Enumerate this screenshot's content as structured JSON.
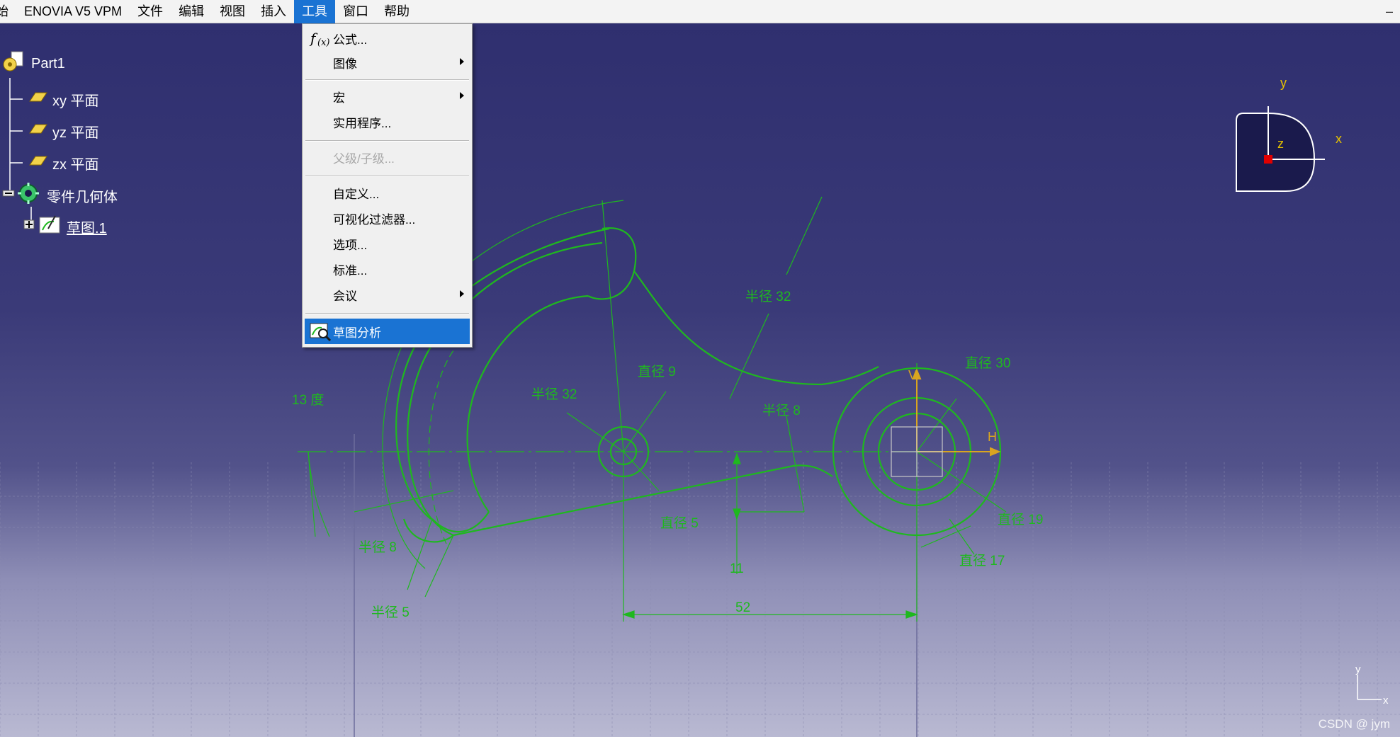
{
  "menubar": {
    "items": [
      "始",
      "ENOVIA V5 VPM",
      "文件",
      "编辑",
      "视图",
      "插入",
      "工具",
      "窗口",
      "帮助"
    ],
    "active_index": 6,
    "minimize": "–"
  },
  "tree": {
    "root": "Part1",
    "planes": [
      "xy 平面",
      "yz 平面",
      "zx 平面"
    ],
    "body": "零件几何体",
    "sketch": "草图.1"
  },
  "tools_menu": {
    "items": [
      {
        "label": "公式...",
        "icon": "formula-icon"
      },
      {
        "label": "图像",
        "submenu": true
      },
      {
        "label": "宏",
        "submenu": true
      },
      {
        "label": "实用程序..."
      },
      {
        "label": "父级/子级...",
        "disabled": true
      },
      {
        "label": "自定义..."
      },
      {
        "label": "可视化过滤器..."
      },
      {
        "label": "选项..."
      },
      {
        "label": "标准..."
      },
      {
        "label": "会议",
        "submenu": true
      },
      {
        "label": "草图分析",
        "icon": "sketch-analysis-icon",
        "selected": true
      }
    ]
  },
  "sketch": {
    "dimensions": {
      "angle_13": "13 度",
      "r32_top": "半径 32",
      "r32_mid": "半径 32",
      "d9": "直径 9",
      "r8_mid": "半径 8",
      "d30": "直径 30",
      "d5": "直径 5",
      "d19": "直径 19",
      "d17": "直径 17",
      "r8_left": "半径 8",
      "r5_left": "半径 5",
      "dim_11": "11",
      "dim_52": "52"
    },
    "axis_h": "H",
    "axis_v": "V"
  },
  "compass": {
    "x": "x",
    "y": "y",
    "z": "z"
  },
  "corner_axis": {
    "x": "x",
    "y": "y"
  },
  "watermark": "CSDN @ jym",
  "colors": {
    "geometry": "#1fb81f",
    "menu_highlight": "#1a73d3",
    "compass_axis": "#e6c200",
    "compass_origin": "#e00000"
  }
}
